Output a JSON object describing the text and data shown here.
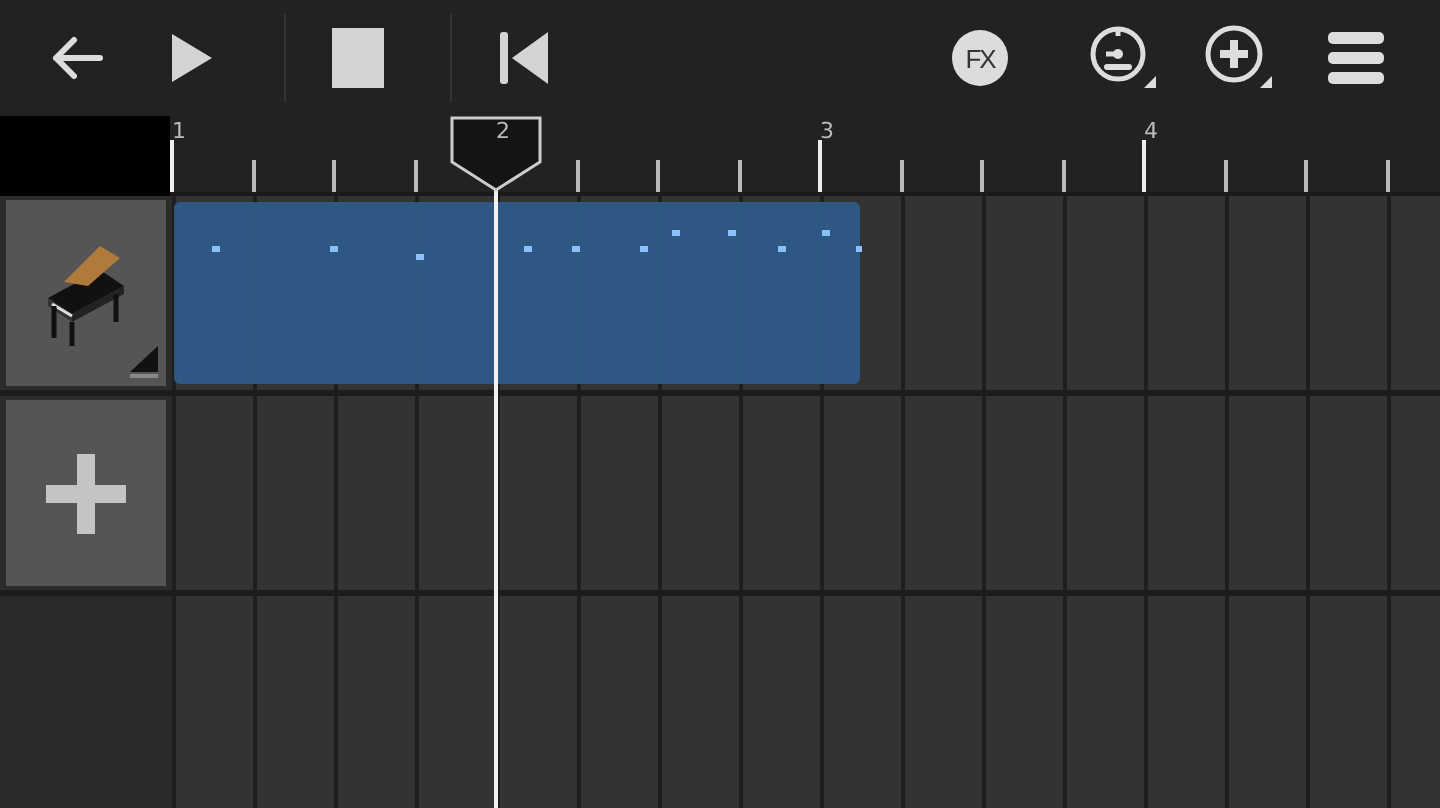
{
  "toolbar": [
    {
      "kind": "back"
    },
    {
      "kind": "play"
    },
    {
      "kind": "separator"
    },
    {
      "kind": "stop"
    },
    {
      "kind": "separator"
    },
    {
      "kind": "rewind"
    },
    {
      "kind": "spacer"
    },
    {
      "kind": "fx",
      "label": "FX"
    },
    {
      "kind": "tempo"
    },
    {
      "kind": "add"
    },
    {
      "kind": "menu"
    }
  ],
  "ruler": {
    "bars": [
      {
        "label": "1",
        "playhead": false
      },
      {
        "label": "2",
        "playhead": true
      },
      {
        "label": "3",
        "playhead": false
      },
      {
        "label": "4",
        "playhead": false
      }
    ]
  },
  "tracks": [
    {
      "kind": "instrument"
    },
    {
      "kind": "add"
    }
  ]
}
